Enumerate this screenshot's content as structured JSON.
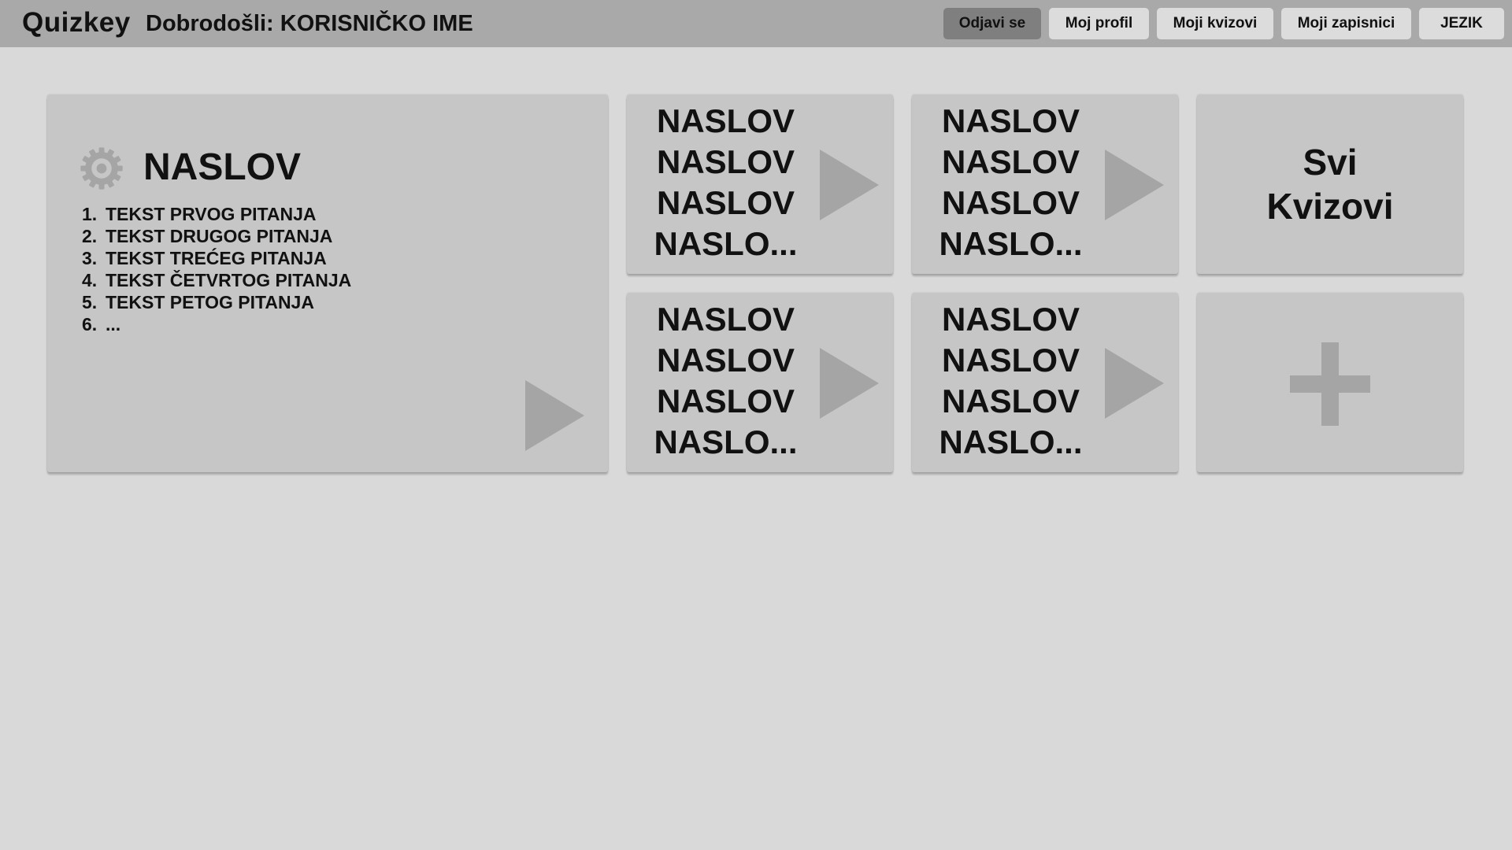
{
  "header": {
    "brand": "Quizkey",
    "welcome": "Dobrodošli: KORISNIČKO IME",
    "nav": [
      {
        "label": "Odjavi se",
        "active": true
      },
      {
        "label": "Moj profil"
      },
      {
        "label": "Moji kvizovi"
      },
      {
        "label": "Moji zapisnici"
      },
      {
        "label": "JEZIK"
      }
    ]
  },
  "featured_quiz": {
    "title": "NASLOV",
    "questions": [
      {
        "num": "1.",
        "text": "TEKST PRVOG PITANJA"
      },
      {
        "num": "2.",
        "text": "TEKST DRUGOG PITANJA"
      },
      {
        "num": "3.",
        "text": "TEKST TREĆEG PITANJA"
      },
      {
        "num": "4.",
        "text": "TEKST ČETVRTOG PITANJA"
      },
      {
        "num": "5.",
        "text": "TEKST PETOG PITANJA"
      },
      {
        "num": "6.",
        "text": "..."
      }
    ]
  },
  "quiz_cards": [
    {
      "lines": [
        "NASLOV",
        "NASLOV",
        "NASLOV",
        "NASLO..."
      ]
    },
    {
      "lines": [
        "NASLOV",
        "NASLOV",
        "NASLOV",
        "NASLO..."
      ]
    },
    {
      "lines": [
        "NASLOV",
        "NASLOV",
        "NASLOV",
        "NASLO..."
      ]
    },
    {
      "lines": [
        "NASLOV",
        "NASLOV",
        "NASLOV",
        "NASLO..."
      ]
    }
  ],
  "all_quizzes": {
    "line1": "Svi",
    "line2": "Kvizovi"
  },
  "icons": {
    "gear": "gear-icon",
    "play": "play-icon",
    "plus": "plus-icon"
  },
  "colors": {
    "background": "#d9d9d9",
    "header": "#a9a9a9",
    "card": "#c6c6c6",
    "button": "#dcdcdc",
    "active_button": "#7f7f7f",
    "icon": "#a5a5a5"
  }
}
